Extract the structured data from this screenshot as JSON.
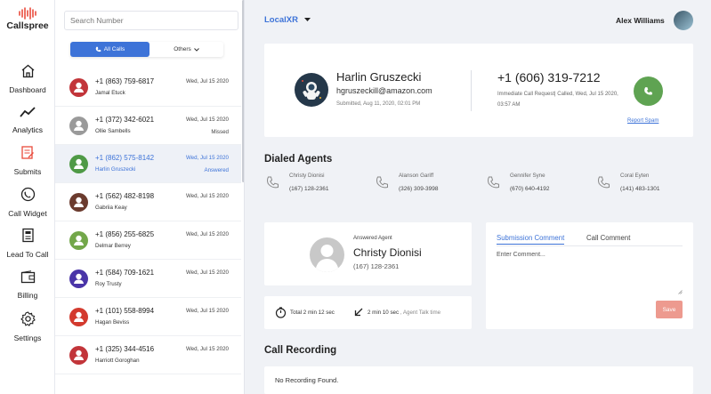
{
  "brand": {
    "name": "Callspree",
    "accent": "#e94b3c"
  },
  "nav": [
    {
      "label": "Dashboard",
      "icon": "home-icon"
    },
    {
      "label": "Analytics",
      "icon": "analytics-icon"
    },
    {
      "label": "Submits",
      "icon": "submits-icon"
    },
    {
      "label": "Call Widget",
      "icon": "call-widget-icon"
    },
    {
      "label": "Lead To Call",
      "icon": "lead-to-call-icon"
    },
    {
      "label": "Billing",
      "icon": "billing-icon"
    },
    {
      "label": "Settings",
      "icon": "settings-icon"
    }
  ],
  "calls": {
    "search_placeholder": "Search Number",
    "tab_all": "All Calls",
    "tab_others": "Others",
    "items": [
      {
        "number": "+1 (863) 759-6817",
        "name": "Jamal Etuck",
        "date": "Wed, Jul 15 2020",
        "status": "",
        "avatar_color": "#c2353a"
      },
      {
        "number": "+1 (372) 342-6021",
        "name": "Ollie Sambells",
        "date": "Wed, Jul 15 2020",
        "status": "Missed",
        "avatar_color": "#9a9a9a"
      },
      {
        "number": "+1 (862) 575-8142",
        "name": "Harlin Gruszecki",
        "date": "Wed, Jul 15 2020",
        "status": "Answered",
        "avatar_color": "#4f9a46"
      },
      {
        "number": "+1 (562) 482-8198",
        "name": "Gabriia Keay",
        "date": "Wed, Jul 15 2020",
        "status": "",
        "avatar_color": "#6b3b2e"
      },
      {
        "number": "+1 (856) 255-6825",
        "name": "Delmar Berrey",
        "date": "Wed, Jul 15 2020",
        "status": "",
        "avatar_color": "#73a74a"
      },
      {
        "number": "+1 (584) 709-1621",
        "name": "Roy Trusty",
        "date": "Wed, Jul 15 2020",
        "status": "",
        "avatar_color": "#4a35a8"
      },
      {
        "number": "+1 (101) 558-8994",
        "name": "Hagan Beviss",
        "date": "Wed, Jul 15 2020",
        "status": "",
        "avatar_color": "#d33a2e"
      },
      {
        "number": "+1 (325) 344-4516",
        "name": "Harriott Goroghan",
        "date": "Wed, Jul 15 2020",
        "status": "",
        "avatar_color": "#c2353a"
      }
    ]
  },
  "header": {
    "account": "LocalXR",
    "user": "Alex Williams"
  },
  "contact": {
    "name": "Harlin Gruszecki",
    "email": "hgruszeckill@amazon.com",
    "submitted": "Submitted, Aug 11, 2020, 02:01 PM",
    "phone": "+1 (606) 319-7212",
    "request_info": "Immediate Call Request| Called, Wed, Jul 15 2020, 03:57 AM",
    "report_spam": "Report Spam",
    "call_color": "#5fa352"
  },
  "dialed": {
    "title": "Dialed Agents",
    "agents": [
      {
        "name": "Christy Dionisi",
        "phone": "(167) 128-2361"
      },
      {
        "name": "Alanson Gariff",
        "phone": "(326) 309-3998"
      },
      {
        "name": "Gennifer Syne",
        "phone": "(670) 640-4192"
      },
      {
        "name": "Coral Eyten",
        "phone": "(141) 483-1301"
      }
    ]
  },
  "answered": {
    "label": "Answered Agent",
    "name": "Christy Dionisi",
    "phone": "(167) 128-2361"
  },
  "durations": {
    "total": "Total 2 min 12 sec",
    "talk_value": "2 min 10 sec",
    "talk_label": ", Agent Talk time"
  },
  "comments": {
    "tab_submission": "Submission Comment",
    "tab_call": "Call Comment",
    "placeholder": "Enter Comment...",
    "save": "Save",
    "save_color": "#ed9a8f"
  },
  "recording": {
    "title": "Call Recording",
    "empty": "No Recording Found."
  }
}
